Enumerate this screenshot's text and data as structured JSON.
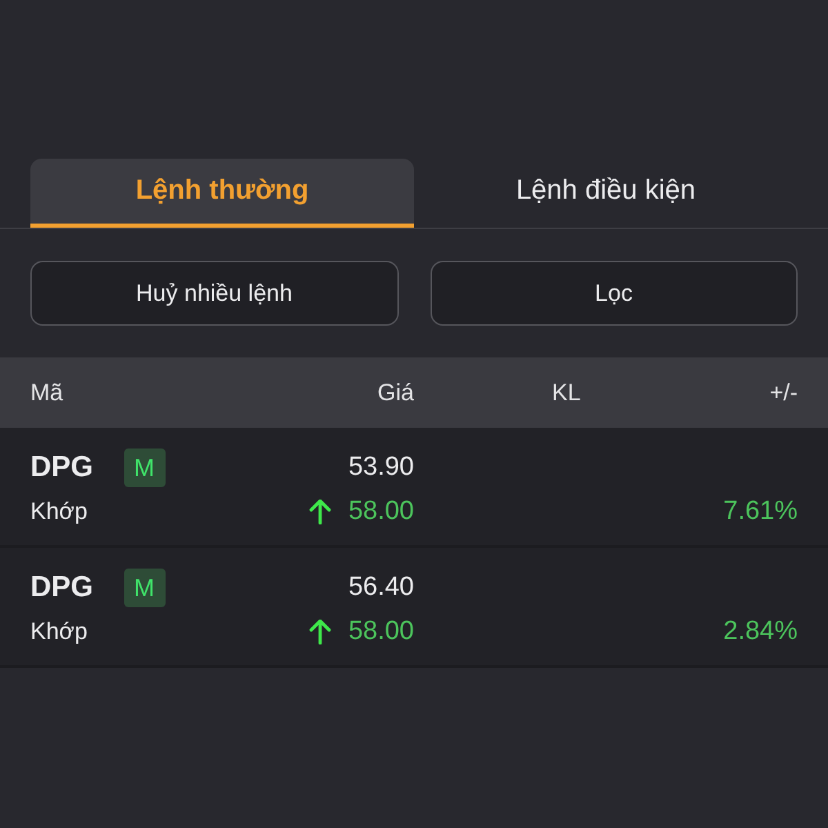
{
  "tabs": [
    {
      "label": "Lệnh thường",
      "selected": true
    },
    {
      "label": "Lệnh điều kiện",
      "selected": false
    }
  ],
  "actions": [
    "Huỷ nhiều lệnh",
    "Lọc"
  ],
  "table": {
    "columns": [
      "Mã",
      "Giá",
      "KL",
      "+/-"
    ],
    "rows": [
      {
        "symbol": "DPG",
        "badge": "M",
        "price": "53.90",
        "status": "Khớp",
        "rising": true,
        "matched_price": "58.00",
        "change": "7.61%"
      },
      {
        "symbol": "DPG",
        "badge": "M",
        "price": "56.40",
        "status": "Khớp",
        "rising": true,
        "matched_price": "58.00",
        "change": "2.84%"
      }
    ]
  }
}
